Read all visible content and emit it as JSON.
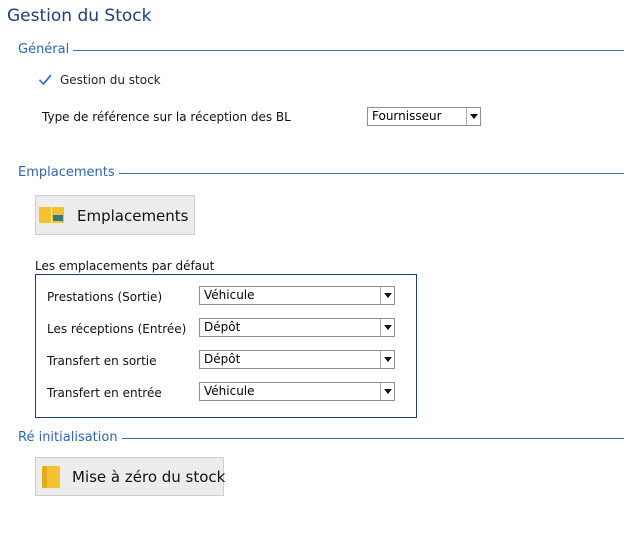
{
  "page": {
    "title": "Gestion du Stock"
  },
  "sections": {
    "general": {
      "title": "Général",
      "stock_checkbox": {
        "label": "Gestion du stock",
        "checked": true
      },
      "ref_type": {
        "label": "Type de référence sur la réception des BL",
        "value": "Fournisseur"
      }
    },
    "emplacements": {
      "title": "Emplacements",
      "button_label": "Emplacements",
      "defaults": {
        "title": "Les emplacements par défaut",
        "rows": [
          {
            "label": "Prestations (Sortie)",
            "value": "Véhicule"
          },
          {
            "label": "Les réceptions (Entrée)",
            "value": "Dépôt"
          },
          {
            "label": "Transfert en sortie",
            "value": "Dépôt"
          },
          {
            "label": "Transfert en entrée",
            "value": "Véhicule"
          }
        ]
      }
    },
    "reinit": {
      "title": "Ré initialisation",
      "button_label": "Mise à zéro du stock"
    }
  },
  "colors": {
    "title": "#1f3d7a",
    "section": "#2e66b0",
    "check": "#3a78c4",
    "folder": "#f2c231"
  }
}
